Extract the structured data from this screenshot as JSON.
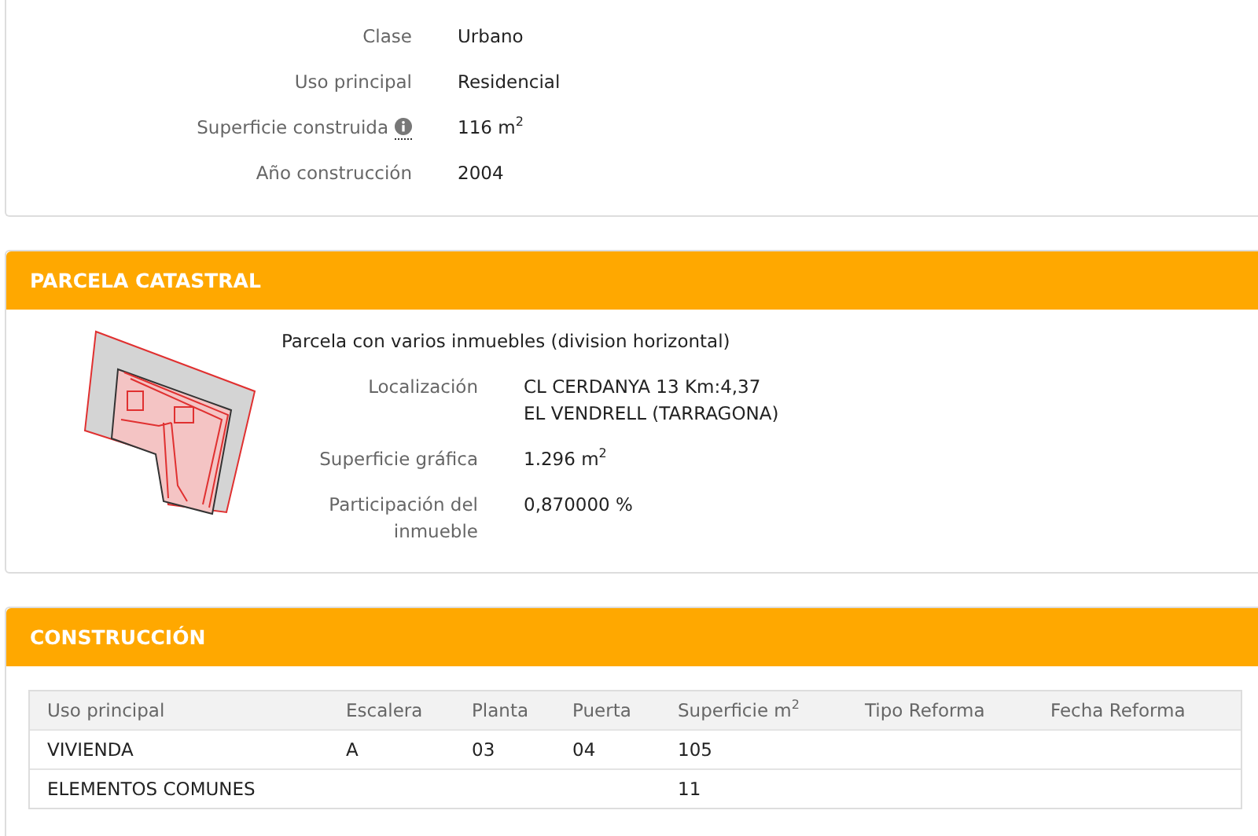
{
  "inmueble": {
    "fields": [
      {
        "label": "Clase",
        "value": "Urbano",
        "info": false
      },
      {
        "label": "Uso principal",
        "value": "Residencial",
        "info": false
      },
      {
        "label": "Superficie construida",
        "value": "116 m$^{2}$",
        "info": true
      },
      {
        "label": "Año construcción",
        "value": "2004",
        "info": false
      }
    ]
  },
  "parcela": {
    "title": "PARCELA CATASTRAL",
    "description": "Parcela con varios inmuebles (division horizontal)",
    "fields": [
      {
        "label": "Localización",
        "lines": [
          "CL CERDANYA 13 Km:4,37",
          "EL VENDRELL (TARRAGONA)"
        ]
      },
      {
        "label": "Superficie gráfica",
        "lines": [
          "1.296 m$^{2}$"
        ]
      },
      {
        "label": "Participación del inmueble",
        "lines": [
          "0,870000 %"
        ]
      }
    ]
  },
  "construccion": {
    "title": "CONSTRUCCIÓN",
    "table": {
      "columns": [
        "Uso principal",
        "Escalera",
        "Planta",
        "Puerta",
        "Superficie m$^{2}$",
        "Tipo Reforma",
        "Fecha Reforma"
      ],
      "rows": [
        [
          "VIVIENDA",
          "A",
          "03",
          "04",
          "105",
          "",
          ""
        ],
        [
          "ELEMENTOS COMUNES",
          "",
          "",
          "",
          "11",
          "",
          ""
        ]
      ]
    }
  }
}
